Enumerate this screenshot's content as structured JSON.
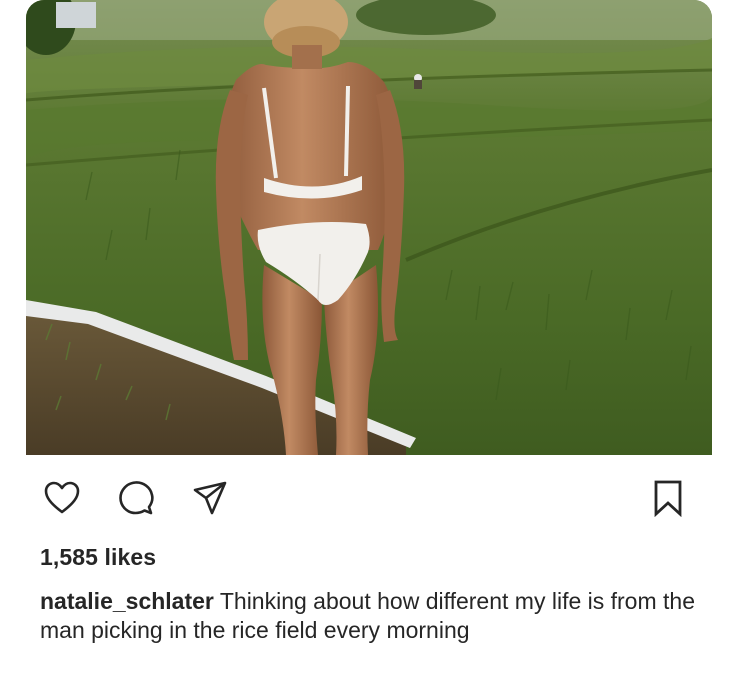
{
  "post": {
    "photo": {
      "icon": "photo-rice-field",
      "accent_colors": {
        "field_green": "#4f6b2c",
        "sky_haze": "#a9b79a",
        "skin": "#b07a55",
        "swimsuit": "#f2f0ec"
      }
    },
    "actions": {
      "like_icon": "heart-outline-icon",
      "comment_icon": "comment-bubble-icon",
      "share_icon": "paper-plane-icon",
      "save_icon": "bookmark-outline-icon"
    },
    "likes_text": "1,585 likes",
    "caption": {
      "username": "natalie_schlater",
      "text": "Thinking about how different my life is from the man picking in the rice field every morning"
    }
  }
}
